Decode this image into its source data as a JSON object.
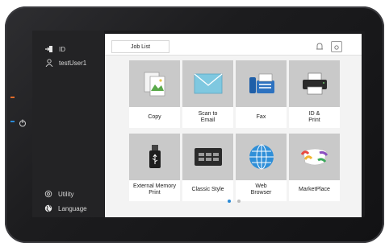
{
  "sidebar": {
    "id_label": "ID",
    "user_label": "testUser1",
    "utility_label": "Utility",
    "language_label": "Language"
  },
  "header": {
    "job_list_label": "Job List"
  },
  "tiles": [
    {
      "label": "Copy"
    },
    {
      "label": "Scan to\nEmail"
    },
    {
      "label": "Fax"
    },
    {
      "label": "ID &\nPrint"
    },
    {
      "label": "External Memory\nPrint"
    },
    {
      "label": "Classic Style"
    },
    {
      "label": "Web\nBrowser"
    },
    {
      "label": "MarketPlace"
    }
  ],
  "pagination": {
    "current": 1,
    "total": 2
  },
  "colors": {
    "accent": "#2a8ad6",
    "screen_bg": "#f3f3f3",
    "tile_bg": "#c9c9c9",
    "status_orange": "#e06a2a"
  }
}
